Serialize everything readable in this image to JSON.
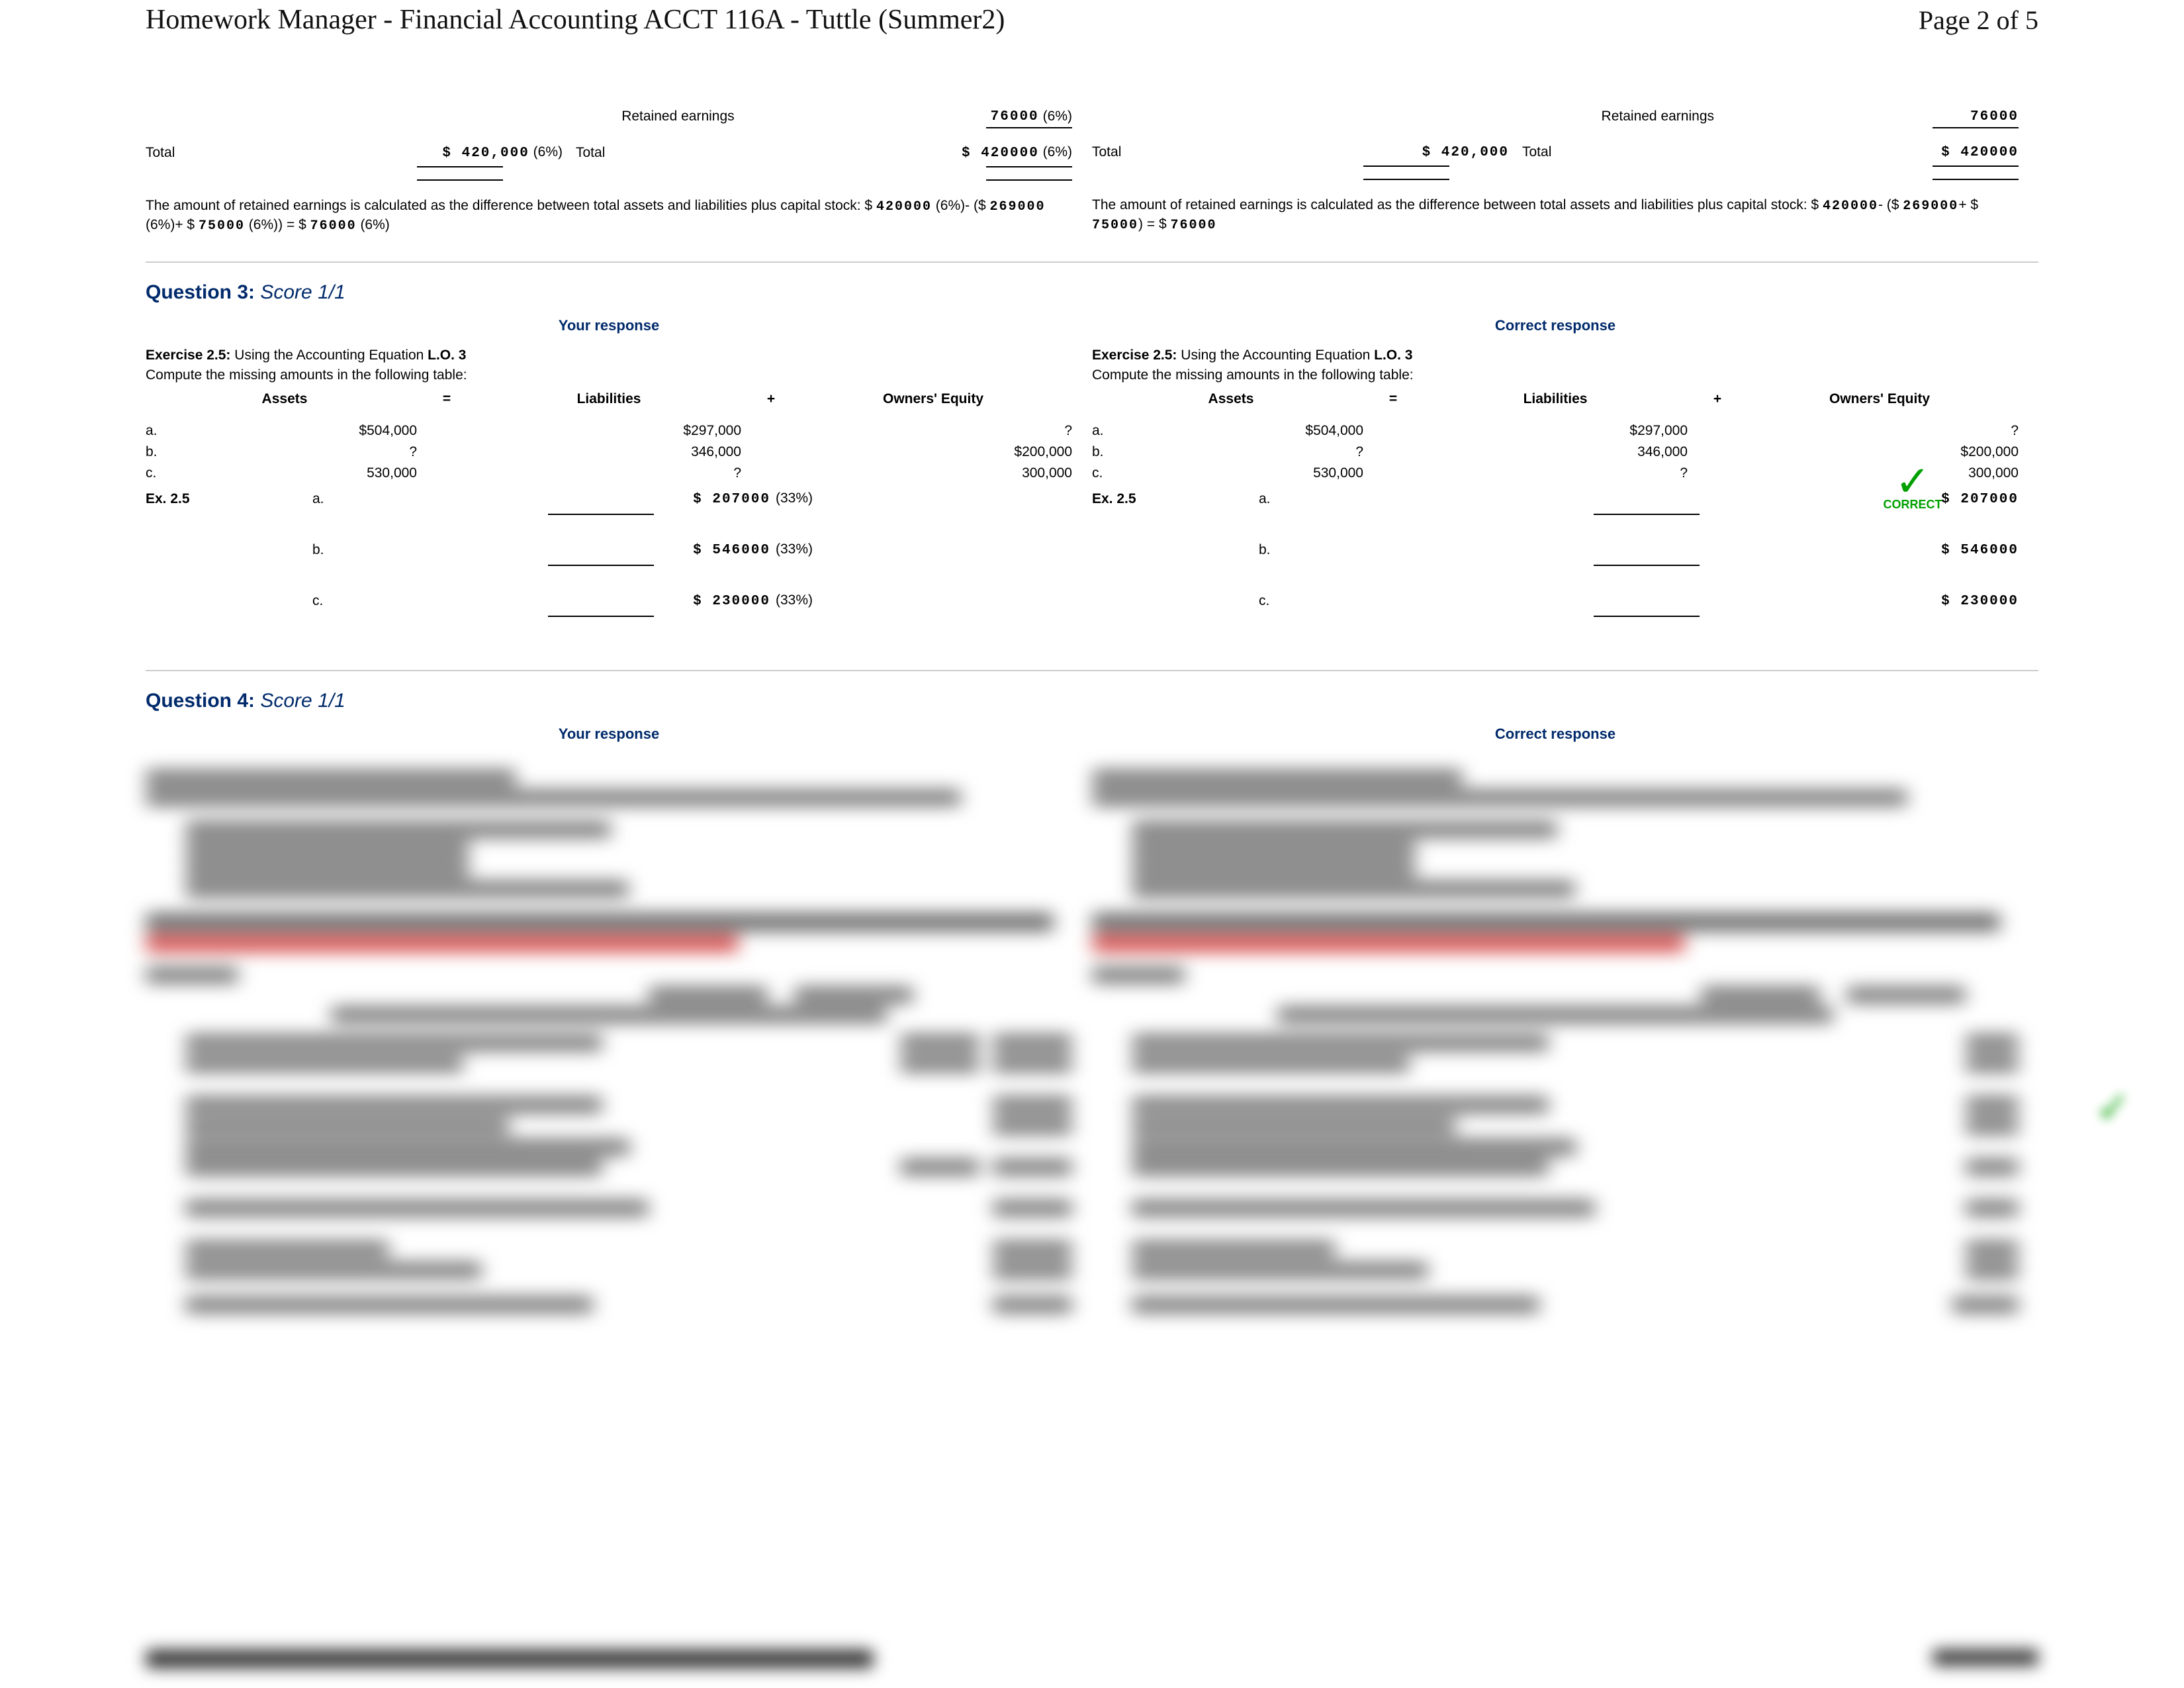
{
  "header": {
    "title": "Homework Manager - Financial Accounting ACCT 116A - Tuttle (Summer2)",
    "page_indicator": "Page 2 of 5"
  },
  "q2_tail": {
    "your": {
      "retained_label": "Retained earnings",
      "retained_value": "76000",
      "retained_pct": "(6%)",
      "total_left_label": "Total",
      "total_left_value": "$ 420,000",
      "total_left_pct": "(6%)",
      "total_right_label": "Total",
      "total_right_value": "$ 420000",
      "total_right_pct": "(6%)",
      "explain_pre": "The amount of retained earnings is calculated as the difference between total assets and liabilities plus capital stock: $ ",
      "e_v1": "420000",
      "e_p1": " (6%)- ($ ",
      "e_v2": "269000",
      "e_p2": " (6%)+ $ ",
      "e_v3": "75000",
      "e_p3": " (6%)) = $ ",
      "e_v4": "76000",
      "e_p4": " (6%)"
    },
    "correct": {
      "retained_label": "Retained earnings",
      "retained_value": "76000",
      "total_left_label": "Total",
      "total_left_value": "$ 420,000",
      "total_right_label": "Total",
      "total_right_value": "$ 420000",
      "explain_pre": "The amount of retained earnings is calculated as the difference between total assets and liabilities plus capital stock: $ ",
      "e_v1": "420000",
      "e_p1": "- ($ ",
      "e_v2": "269000",
      "e_p2": "+ $ ",
      "e_v3": "75000",
      "e_p3": ") = $ ",
      "e_v4": "76000"
    }
  },
  "q3": {
    "title": "Question 3: ",
    "score": "Score 1/1",
    "your_label": "Your response",
    "correct_label": "Correct response",
    "ex_strong": "Exercise 2.5:",
    "ex_rest": " Using the Accounting Equation ",
    "ex_lo": "L.O. 3",
    "compute": "Compute the missing amounts in the following table:",
    "headers": {
      "assets": "Assets",
      "eq": "=",
      "liab": "Liabilities",
      "plus": "+",
      "oe": "Owners' Equity"
    },
    "rows": [
      {
        "l": "a.",
        "a": "$504,000",
        "li": "$297,000",
        "oe": "?"
      },
      {
        "l": "b.",
        "a": "?",
        "li": "346,000",
        "oe": "$200,000"
      },
      {
        "l": "c.",
        "a": "530,000",
        "li": "?",
        "oe": "300,000"
      }
    ],
    "ex_short": "Ex. 2.5",
    "your_answers": [
      {
        "l": "a.",
        "v": "$ 207000",
        "pct": "(33%)"
      },
      {
        "l": "b.",
        "v": "$ 546000",
        "pct": "(33%)"
      },
      {
        "l": "c.",
        "v": "$ 230000",
        "pct": "(33%)"
      }
    ],
    "correct_answers": [
      {
        "l": "a.",
        "v": "$ 207000"
      },
      {
        "l": "b.",
        "v": "$ 546000"
      },
      {
        "l": "c.",
        "v": "$ 230000"
      }
    ],
    "correct_mark": "✓",
    "correct_text": "CORRECT"
  },
  "q4": {
    "title": "Question 4: ",
    "score": "Score 1/1",
    "your_label": "Your response",
    "correct_label": "Correct response"
  }
}
